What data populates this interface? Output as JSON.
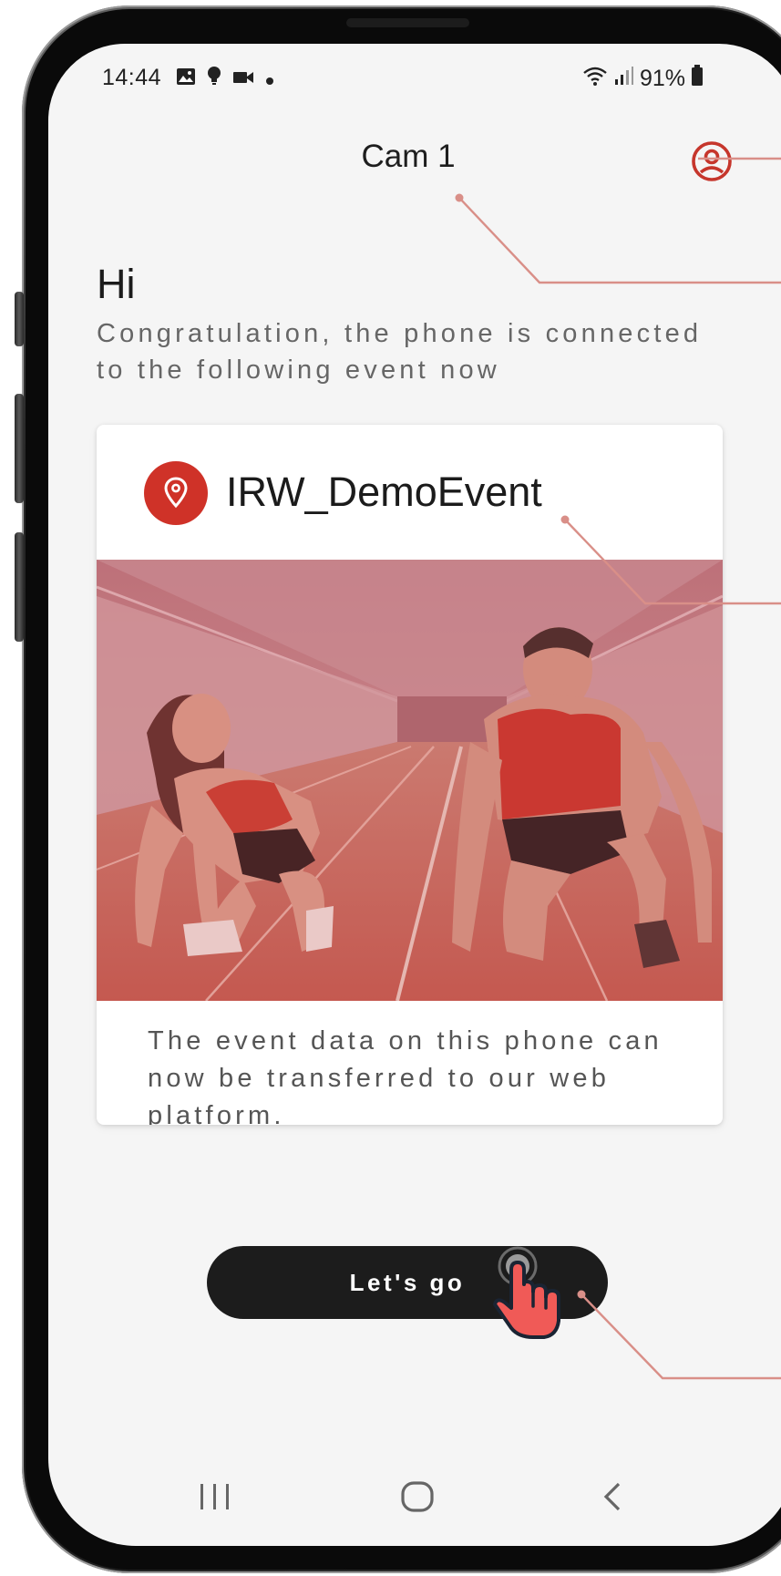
{
  "status_bar": {
    "time": "14:44",
    "left_icons": [
      "image-icon",
      "bulb-icon",
      "video-icon",
      "dot-icon"
    ],
    "battery": "91%",
    "right_icons": [
      "wifi-icon",
      "signal-icon",
      "battery-icon"
    ]
  },
  "app_bar": {
    "title": "Cam 1",
    "profile_icon": "account-circle-icon"
  },
  "content": {
    "greeting": "Hi",
    "message": "Congratulation, the phone is connected to the following event now"
  },
  "event_card": {
    "icon": "location-pin-icon",
    "event_name": "IRW_DemoEvent",
    "image_description": "two sprinters in starting position on a running track",
    "description": "The event data on this phone can now be transferred to our web platform."
  },
  "cta": {
    "label": "Let's go",
    "tap_indicator": "tap-hand-icon"
  },
  "nav_bar": {
    "items": [
      "recent-apps-icon",
      "home-icon",
      "back-icon"
    ]
  },
  "colors": {
    "accent": "#cf3228",
    "screen_background": "#f5f5f5",
    "button": "#1c1c1c",
    "callout_line": "#d98f88"
  }
}
